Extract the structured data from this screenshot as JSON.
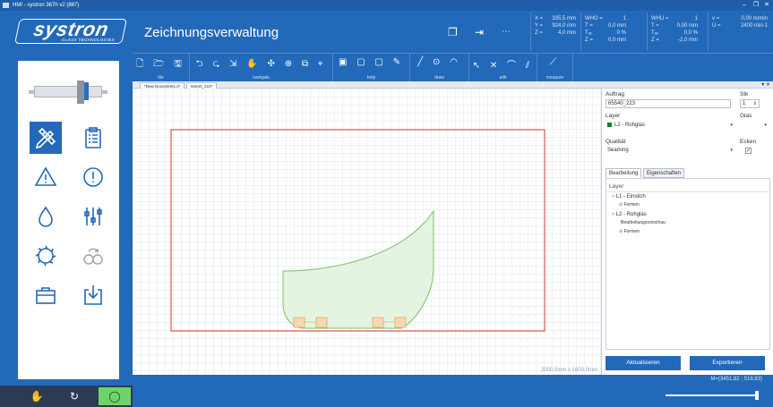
{
  "window": {
    "title": "HMI - systron 367h v2 (867)",
    "controls": [
      "–",
      "❐",
      "✕"
    ]
  },
  "header": {
    "logo_text": "systron",
    "logo_sub": "GLASS TECHNOLOGIES",
    "app_title": "Zeichnungsverwaltung",
    "coords1": [
      {
        "label": "X =",
        "value": "335,5 mm"
      },
      {
        "label": "Y =",
        "value": "924,0 mm"
      },
      {
        "label": "Z =",
        "value": "4,0 mm"
      }
    ],
    "coords2": [
      {
        "label": "WHO =",
        "value": "1"
      },
      {
        "label": "T =",
        "value": "0,0 mm"
      },
      {
        "label": "Tₐᵥ",
        "value": "0 %"
      },
      {
        "label": "Z =",
        "value": "0,0 mm"
      }
    ],
    "coords3": [
      {
        "label": "WHU =",
        "value": "1"
      },
      {
        "label": "T =",
        "value": "0,00 mm"
      },
      {
        "label": "Tₐᵥ",
        "value": "0,0 %"
      },
      {
        "label": "Z =",
        "value": "-2,0 mm"
      }
    ],
    "coords4": [
      {
        "label": "v =",
        "value": "0,00 m/min"
      },
      {
        "label": "U =",
        "value": "2400 min-1"
      }
    ]
  },
  "toolbar": {
    "groups": [
      {
        "label": "file",
        "icons": "🗋 🗁 🖫"
      },
      {
        "label": "navigate",
        "icons": "⮌ ⮎ ⇲ ✋ ✣ ⊕ ⧉ ⌖"
      },
      {
        "label": "help",
        "icons": "▣ ▢ ▢ ✎"
      },
      {
        "label": "draw",
        "icons": "╱ ⊙ ◠"
      },
      {
        "label": "edit",
        "icons": "↖ ✕ ⌒ ⫽"
      },
      {
        "label": "measure",
        "icons": "⟋"
      }
    ]
  },
  "tabs": [
    {
      "label": "*New Document1.s*"
    },
    {
      "label": "65540_223*"
    }
  ],
  "canvas": {
    "status": "2000,0mm x 1600,0mm"
  },
  "properties": {
    "auftrag_label": "Auftrag",
    "auftrag_value": "65540_223",
    "stk_label": "Stk",
    "stk_value": "1",
    "layer_label": "Layer",
    "layer_value": "L2 - Rohglas",
    "glas_label": "Glas",
    "qualitaet_label": "Qualität",
    "qualitaet_value": "Seaming",
    "ecken_label": "Ecken",
    "ecken_checked": "✓",
    "tab_bearbeitung": "Bearbeitung",
    "tab_eigenschaften": "Eigenschaften",
    "tree_header": "Layer",
    "tree": [
      "L1 - Einstich",
      "Formen",
      "L2 - Rohglas",
      "Bearbeitungsvorschau",
      "Formen"
    ],
    "btn_update": "Aktualisieren",
    "btn_export": "Exportieren"
  },
  "statusbar": {
    "mouse": "M=(3451,82 ; 516,63)"
  },
  "colors": {
    "primary": "#2369b9",
    "shape_fill": "#e4f4e0",
    "shape_stroke": "#7bbf6e",
    "frame": "#d9352b"
  }
}
